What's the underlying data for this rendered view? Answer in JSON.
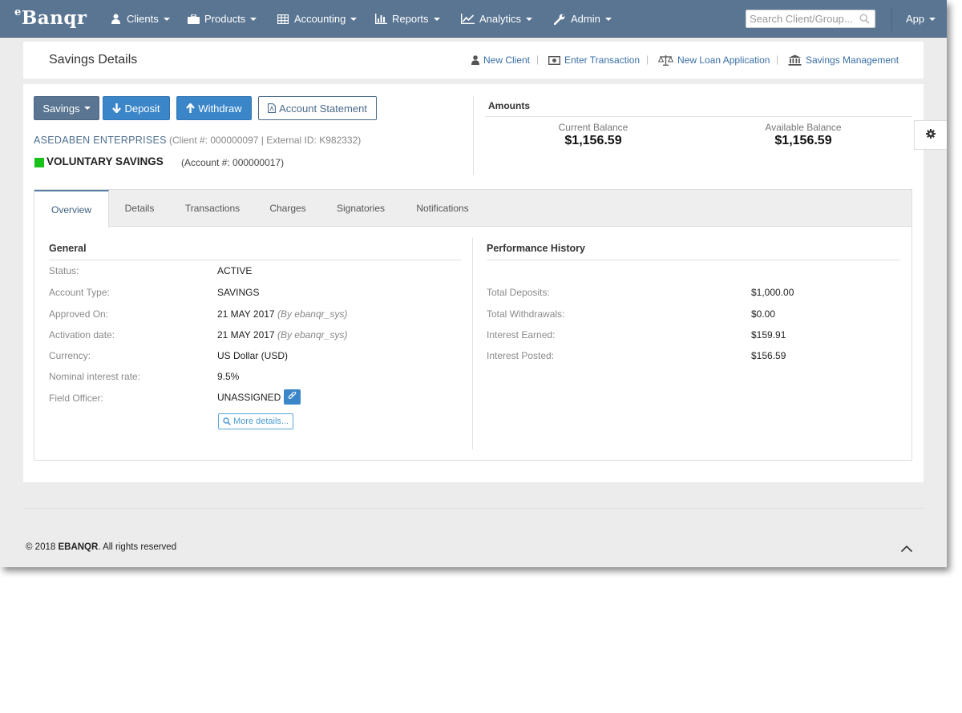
{
  "brand": {
    "prefix": "e",
    "name": "Banqr"
  },
  "nav": {
    "items": [
      {
        "label": "Clients",
        "icon": "user-icon"
      },
      {
        "label": "Products",
        "icon": "briefcase-icon"
      },
      {
        "label": "Accounting",
        "icon": "table-icon"
      },
      {
        "label": "Reports",
        "icon": "bar-chart-icon"
      },
      {
        "label": "Analytics",
        "icon": "line-chart-icon"
      },
      {
        "label": "Admin",
        "icon": "wrench-icon"
      }
    ],
    "search_placeholder": "Search Client/Group...",
    "app_label": "App"
  },
  "header": {
    "title": "Savings Details",
    "quick_links": [
      {
        "label": "New Client",
        "icon": "user-icon"
      },
      {
        "label": "Enter Transaction",
        "icon": "money-icon"
      },
      {
        "label": "New Loan Application",
        "icon": "balance-scale-icon"
      },
      {
        "label": "Savings Management",
        "icon": "bank-icon"
      }
    ],
    "separator": "|"
  },
  "actions": {
    "savings": "Savings",
    "deposit": "Deposit",
    "withdraw": "Withdraw",
    "statement": "Account Statement"
  },
  "client": {
    "name": "ASEDABEN ENTERPRISES",
    "ids": "(Client #: 000000097 | External ID: K982332)"
  },
  "product": {
    "name": "VOLUNTARY SAVINGS",
    "account": "(Account #: 000000017)",
    "status_color": "#18c21a"
  },
  "amounts": {
    "title": "Amounts",
    "current_label": "Current Balance",
    "current_value": "$1,156.59",
    "available_label": "Available Balance",
    "available_value": "$1,156.59"
  },
  "tabs": [
    "Overview",
    "Details",
    "Transactions",
    "Charges",
    "Signatories",
    "Notifications"
  ],
  "general": {
    "title": "General",
    "rows": [
      {
        "label": "Status:",
        "value": "ACTIVE",
        "by": ""
      },
      {
        "label": "Account Type:",
        "value": "SAVINGS",
        "by": ""
      },
      {
        "label": "Approved On:",
        "value": "21 MAY 2017",
        "by": "(By ebanqr_sys)"
      },
      {
        "label": "Activation date:",
        "value": "21 MAY 2017",
        "by": "(By ebanqr_sys)"
      },
      {
        "label": "Currency:",
        "value": "US Dollar (USD)",
        "by": ""
      },
      {
        "label": "Nominal interest rate:",
        "value": "9.5%",
        "by": ""
      },
      {
        "label": "Field Officer:",
        "value": "UNASSIGNED",
        "by": ""
      }
    ],
    "more_details": "More details..."
  },
  "performance": {
    "title": "Performance History",
    "rows": [
      {
        "label": "Total Deposits:",
        "value": "$1,000.00"
      },
      {
        "label": "Total Withdrawals:",
        "value": "$0.00"
      },
      {
        "label": "Interest Earned:",
        "value": "$159.91"
      },
      {
        "label": "Interest Posted:",
        "value": "$156.59"
      }
    ]
  },
  "footer": {
    "copyright": "© 2018",
    "company": "EBANQR",
    "rights": ". All rights reserved"
  }
}
